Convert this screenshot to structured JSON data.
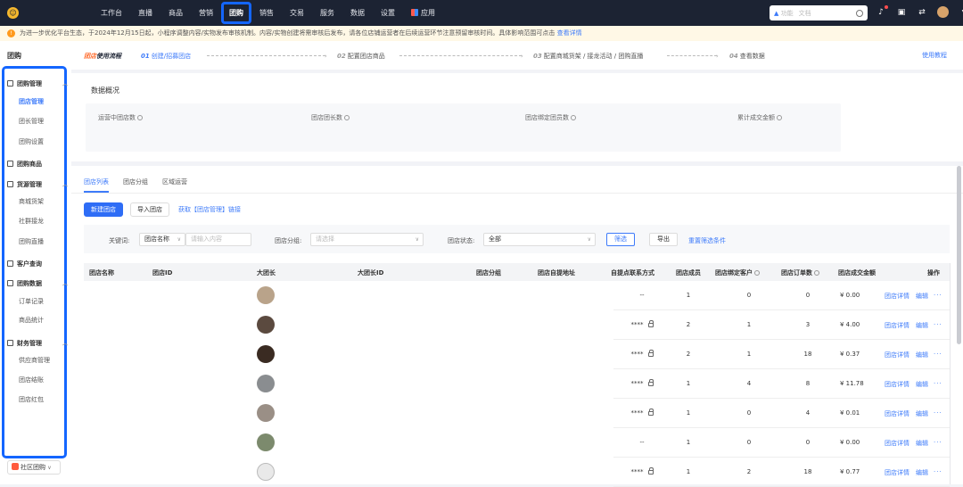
{
  "nav": {
    "items": [
      "工作台",
      "直播",
      "商品",
      "营销",
      "团购",
      "销售",
      "交易",
      "服务",
      "数据",
      "设置"
    ],
    "active": "团购",
    "apps_label": "应用",
    "search_tag": "功能",
    "search_placeholder": "文档"
  },
  "notice": {
    "text": "为进一步优化平台生态，于2024年12月15日起，小程序调整内容/实物发布审核机制。内容/实物创建将需审核后发布，请各位店铺运营者在后续运营环节注意预留审核时间。具体影响范围可点击",
    "link": "查看详情"
  },
  "sidebar": {
    "title": "团购",
    "groups": [
      {
        "label": "团购管理",
        "items": [
          "团店管理",
          "团长管理",
          "团购设置"
        ]
      },
      {
        "label": "团购商品",
        "items": []
      },
      {
        "label": "货源管理",
        "items": [
          "商城货架",
          "社群接龙",
          "团购直播"
        ]
      },
      {
        "label": "客户查询",
        "items": []
      },
      {
        "label": "团购数据",
        "items": [
          "订单记录",
          "商品统计"
        ]
      },
      {
        "label": "财务管理",
        "items": [
          "供应商管理",
          "团店结账",
          "团店红包"
        ]
      }
    ],
    "active_item": "团店管理",
    "bottom_label": "社区团购"
  },
  "steps": {
    "brand_a": "团店",
    "brand_b": "使用流程",
    "items": [
      {
        "n": "01",
        "label": "创建/招募团店"
      },
      {
        "n": "02",
        "label": "配置团店商品"
      },
      {
        "n": "03",
        "label": "配置商城货架 / 接龙活动 / 团购直播"
      },
      {
        "n": "04",
        "label": "查看数据"
      }
    ],
    "help": "使用教程"
  },
  "overview": {
    "title": "数据概况",
    "metrics": [
      "运营中团店数",
      "团店团长数",
      "团店绑定团员数",
      "累计成交金额"
    ]
  },
  "tabs": [
    "团店列表",
    "团店分组",
    "区域运营"
  ],
  "actions": {
    "new": "新建团店",
    "import": "导入团店",
    "link": "获取【团店管理】链接"
  },
  "filter": {
    "keyword_label": "关键词:",
    "keyword_type": "团店名称",
    "keyword_placeholder": "请输入内容",
    "group_label": "团店分组:",
    "group_placeholder": "请选择",
    "status_label": "团店状态:",
    "status_value": "全部",
    "search_btn": "筛选",
    "export_btn": "导出",
    "reset_link": "重置筛选条件"
  },
  "table": {
    "headers": [
      "团店名称",
      "团店ID",
      "大团长",
      "大团长ID",
      "团店分组",
      "团店自提地址",
      "自提点联系方式",
      "团店成员",
      "团店绑定客户",
      "团店订单数",
      "团店成交金额",
      "操作"
    ],
    "rows": [
      {
        "phone": "--",
        "members": "1",
        "customers": "0",
        "orders": "0",
        "amount": "¥ 0.00",
        "avatar": "#b9a38a"
      },
      {
        "phone": "****",
        "members": "2",
        "customers": "1",
        "orders": "3",
        "amount": "¥ 4.00",
        "avatar": "#5b4a3f"
      },
      {
        "phone": "****",
        "members": "2",
        "customers": "1",
        "orders": "18",
        "amount": "¥ 0.37",
        "avatar": "#3a2b22"
      },
      {
        "phone": "****",
        "members": "1",
        "customers": "4",
        "orders": "8",
        "amount": "¥ 11.78",
        "avatar": "#8a8d90"
      },
      {
        "phone": "****",
        "members": "1",
        "customers": "0",
        "orders": "4",
        "amount": "¥ 0.01",
        "avatar": "#9a8f86"
      },
      {
        "phone": "--",
        "members": "1",
        "customers": "0",
        "orders": "0",
        "amount": "¥ 0.00",
        "avatar": "#7c8a6d"
      },
      {
        "phone": "****",
        "members": "1",
        "customers": "2",
        "orders": "18",
        "amount": "¥ 0.77",
        "avatar": "#e9e9e9"
      }
    ],
    "action_detail": "团店详情",
    "action_edit": "编辑",
    "action_more": "···"
  }
}
